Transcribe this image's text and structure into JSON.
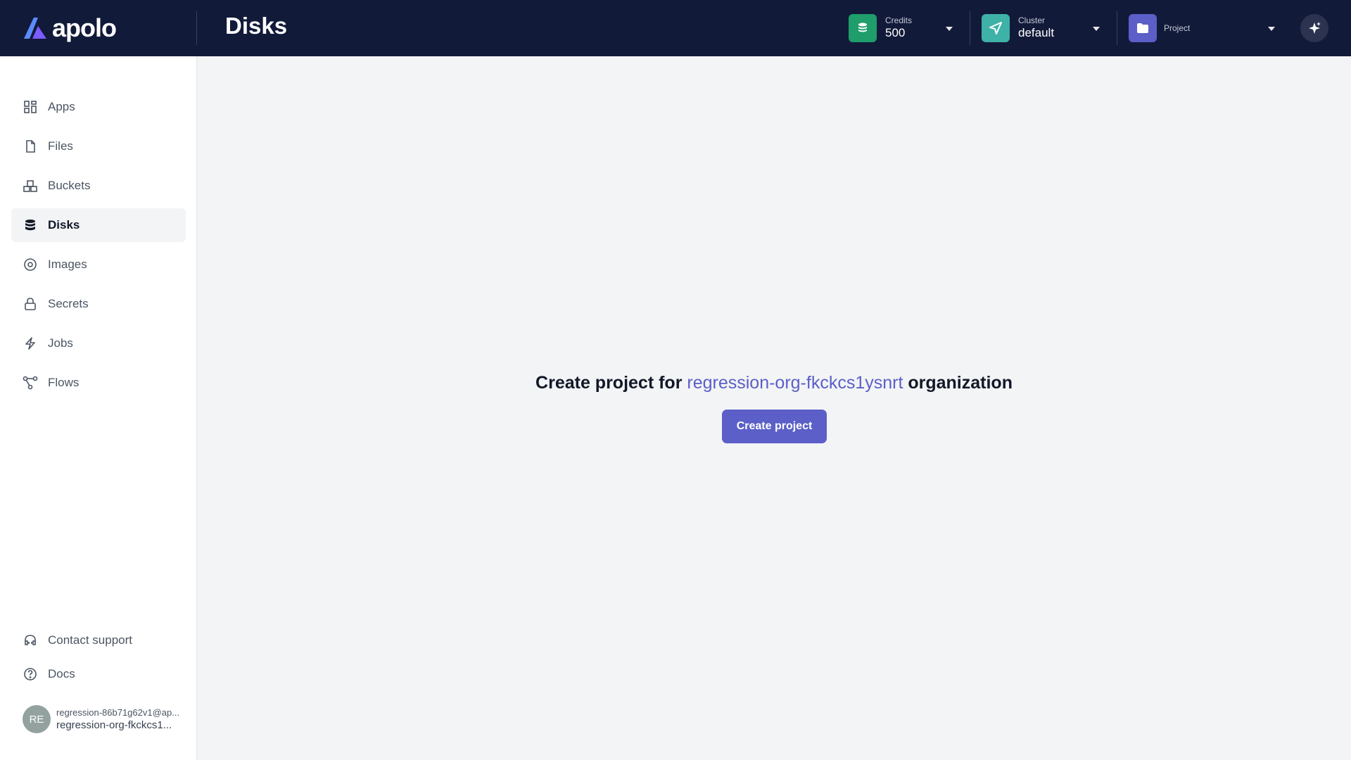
{
  "brand": {
    "name": "apolo"
  },
  "header": {
    "title": "Disks",
    "credits": {
      "label": "Credits",
      "value": "500",
      "color": "#1f9d6b"
    },
    "cluster": {
      "label": "Cluster",
      "value": "default",
      "color": "#3fb2a8"
    },
    "project": {
      "label": "Project",
      "color": "#5b5fc7"
    },
    "ai_icon": "sparkles-icon"
  },
  "sidebar": {
    "items": [
      {
        "label": "Apps",
        "icon": "apps-grid-icon"
      },
      {
        "label": "Files",
        "icon": "file-icon"
      },
      {
        "label": "Buckets",
        "icon": "buckets-icon"
      },
      {
        "label": "Disks",
        "icon": "database-icon",
        "active": true
      },
      {
        "label": "Images",
        "icon": "image-disc-icon"
      },
      {
        "label": "Secrets",
        "icon": "lock-icon"
      },
      {
        "label": "Jobs",
        "icon": "lightning-icon"
      },
      {
        "label": "Flows",
        "icon": "flow-icon"
      }
    ],
    "footer": [
      {
        "label": "Contact support",
        "icon": "headset-icon"
      },
      {
        "label": "Docs",
        "icon": "help-circle-icon"
      }
    ],
    "user": {
      "initials": "RE",
      "email": "regression-86b71g62v1@ap...",
      "org": "regression-org-fkckcs1..."
    }
  },
  "main": {
    "prefix": "Create project for ",
    "org_name": "regression-org-fkckcs1ysnrt",
    "suffix": " organization",
    "button_label": "Create project"
  },
  "colors": {
    "header_bg": "#121a3a",
    "accent": "#5b5fc7",
    "page_bg": "#f3f4f6"
  }
}
